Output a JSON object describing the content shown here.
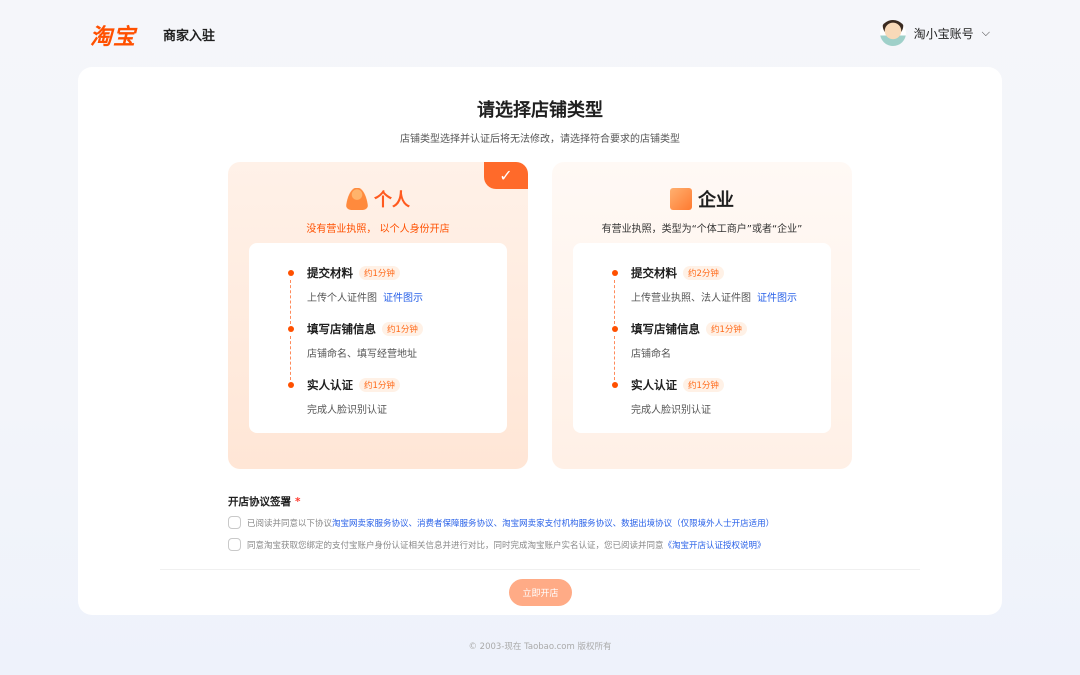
{
  "header": {
    "logo_text": "淘宝",
    "brand_sub": "商家入驻",
    "account_name": "淘小宝账号"
  },
  "page": {
    "title": "请选择店铺类型",
    "subtitle": "店铺类型选择并认证后将无法修改，请选择符合要求的店铺类型"
  },
  "store_types": [
    {
      "name": "个人",
      "description": "没有营业执照， 以个人身份开店",
      "selected": true,
      "steps": [
        {
          "title": "提交材料",
          "time": "约1分钟",
          "desc": "上传个人证件图",
          "link": "证件图示"
        },
        {
          "title": "填写店铺信息",
          "time": "约1分钟",
          "desc": "店铺命名、填写经营地址",
          "link": ""
        },
        {
          "title": "实人认证",
          "time": "约1分钟",
          "desc": "完成人脸识别认证",
          "link": ""
        }
      ]
    },
    {
      "name": "企业",
      "description": "有营业执照，类型为“个体工商户”或者“企业”",
      "selected": false,
      "steps": [
        {
          "title": "提交材料",
          "time": "约2分钟",
          "desc": "上传营业执照、法人证件图",
          "link": "证件图示"
        },
        {
          "title": "填写店铺信息",
          "time": "约1分钟",
          "desc": "店铺命名",
          "link": ""
        },
        {
          "title": "实人认证",
          "time": "约1分钟",
          "desc": "完成人脸识别认证",
          "link": ""
        }
      ]
    }
  ],
  "agreement": {
    "title": "开店协议签署",
    "required_mark": "*",
    "row1_prefix": "已阅读并同意以下协议",
    "row1_links": [
      "淘宝网卖家服务协议",
      "、",
      "消费者保障服务协议",
      "、",
      "淘宝网卖家支付机构服务协议",
      "、",
      "数据出境协议（仅限境外人士开店适用）"
    ],
    "row2_text": "同意淘宝获取您绑定的支付宝账户身份认证相关信息并进行对比，同时完成淘宝账户实名认证，您已阅读并同意",
    "row2_link": "《淘宝开店认证授权说明》"
  },
  "submit_label": "立即开店",
  "footer": "© 2003-现在 Taobao.com 版权所有",
  "colors": {
    "accent": "#ff5000",
    "link": "#2a62e8"
  }
}
